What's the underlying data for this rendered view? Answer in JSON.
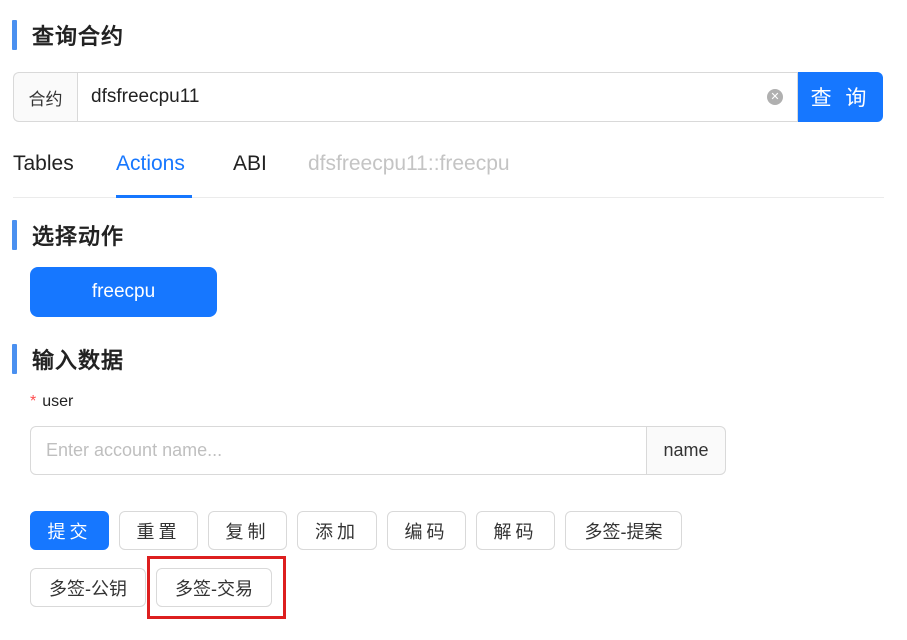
{
  "query_section": {
    "title": "查询合约",
    "addon_label": "合约",
    "contract_value": "dfsfreecpu11",
    "search_label": "查 询"
  },
  "tabs": [
    {
      "label": "Tables",
      "state": "normal"
    },
    {
      "label": "Actions",
      "state": "active"
    },
    {
      "label": "ABI",
      "state": "normal"
    },
    {
      "label": "dfsfreecpu11::freecpu",
      "state": "disabled"
    }
  ],
  "action_section": {
    "title": "选择动作",
    "action_button_label": "freecpu"
  },
  "input_section": {
    "title": "输入数据",
    "field_required_mark": "*",
    "field_label": "user",
    "account_placeholder": "Enter account name...",
    "account_suffix": "name"
  },
  "operations": [
    {
      "label": "提交",
      "type": "primary"
    },
    {
      "label": "重置",
      "type": "default"
    },
    {
      "label": "复制",
      "type": "default"
    },
    {
      "label": "添加",
      "type": "default"
    },
    {
      "label": "编码",
      "type": "default"
    },
    {
      "label": "解码",
      "type": "default"
    },
    {
      "label": "多签-提案",
      "type": "default"
    },
    {
      "label": "多签-公钥",
      "type": "default"
    },
    {
      "label": "多签-交易",
      "type": "default"
    }
  ],
  "colors": {
    "primary": "#1677ff",
    "accent_bar": "#4a90f0",
    "highlight": "#dd1f1f"
  }
}
